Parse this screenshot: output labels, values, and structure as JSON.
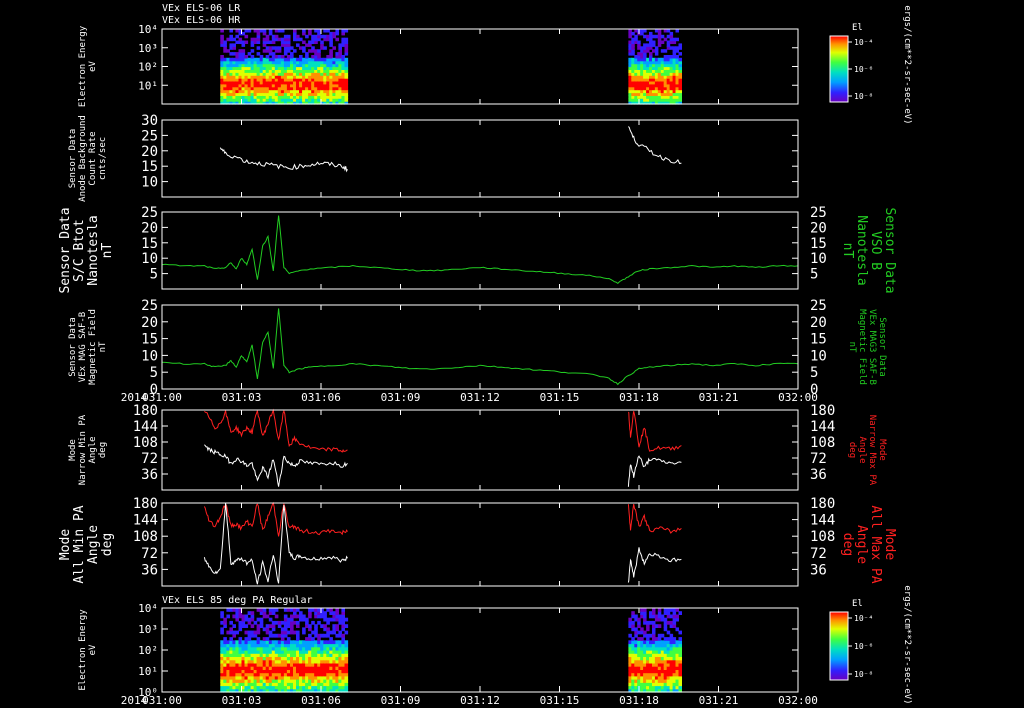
{
  "header": {
    "line1": "VEx ELS-06 LR",
    "line2": "VEx ELS-06 HR",
    "bottom_title": "VEx ELS 85 deg PA Regular"
  },
  "colors": {
    "white": "#ffffff",
    "green": "#22cc22",
    "red": "#ff2020",
    "axis": "#ffffff",
    "background": "#000000"
  },
  "time_axis": {
    "year_label": "2014",
    "ticks": [
      "031:00",
      "031:03",
      "031:06",
      "031:09",
      "031:12",
      "031:15",
      "031:18",
      "031:21",
      "032:00"
    ],
    "range_min": [
      0,
      60
    ]
  },
  "colorbars": [
    {
      "title": "El",
      "ticks": [
        "10⁻⁴",
        "10⁻⁶",
        "10⁻⁸"
      ],
      "unit_label": "ergs/(cm**2-sr-sec-eV)"
    },
    {
      "title": "El",
      "ticks": [
        "10⁻⁴",
        "10⁻⁶",
        "10⁻⁸"
      ],
      "unit_label": "ergs/(cm**2-sr-sec-eV)"
    }
  ],
  "chart_data": [
    {
      "type": "heatmap",
      "ylabel": [
        "Electron Energy",
        "eV"
      ],
      "yscale": "log",
      "ylim": [
        1,
        10000
      ],
      "ytick_labels": [
        "10⁴",
        "10³",
        "10²",
        "10¹"
      ],
      "data_intervals_min": [
        [
          5.5,
          17.5
        ],
        [
          44,
          49
        ]
      ],
      "colorscale": [
        "#6a00c0",
        "#3020ff",
        "#00a0ff",
        "#00e0c0",
        "#40ff40",
        "#e0ff00",
        "#ff9000",
        "#ff0000"
      ]
    },
    {
      "type": "line",
      "ylabel": [
        "Sensor Data",
        "Anode Background",
        "Count Rate",
        "cnts/sec"
      ],
      "ylim": [
        5,
        30
      ],
      "yticks": [
        10,
        15,
        20,
        25,
        30
      ],
      "series": [
        {
          "color": "white",
          "x": [
            5.5,
            6,
            7,
            8,
            9,
            10,
            11,
            12,
            13,
            14,
            15,
            16,
            17,
            17.5
          ],
          "values": [
            21,
            19,
            18,
            16.5,
            16,
            15.5,
            15,
            14.5,
            15,
            15.5,
            16,
            15.5,
            15,
            14
          ]
        },
        {
          "color": "white",
          "x": [
            44,
            44.5,
            45,
            46,
            47,
            48,
            49
          ],
          "values": [
            28,
            24,
            22,
            20,
            18,
            17,
            16
          ]
        }
      ]
    },
    {
      "type": "line",
      "ylabel": [
        "Sensor Data",
        "S/C Btot",
        "Nanotesla",
        "nT"
      ],
      "ylabel_right": [
        "Sensor Data",
        "VSO B",
        "Nanotesla",
        "nT"
      ],
      "ylim": [
        0,
        25
      ],
      "yticks": [
        5,
        10,
        15,
        20,
        25
      ],
      "series": [
        {
          "color": "green",
          "x": [
            0,
            2,
            4,
            5,
            6,
            6.5,
            7,
            7.5,
            8,
            8.5,
            9,
            9.5,
            10,
            10.5,
            11,
            11.5,
            12,
            13,
            14,
            16,
            18,
            20,
            22,
            24,
            26,
            28,
            30,
            32,
            34,
            36,
            38,
            40,
            42,
            43,
            44,
            45,
            46,
            48,
            50,
            52,
            54,
            56,
            58,
            60
          ],
          "values": [
            8,
            7.5,
            7.5,
            6.5,
            7,
            8.5,
            6.5,
            10,
            8,
            13,
            3,
            14,
            17,
            6,
            24,
            7,
            5,
            6,
            6.5,
            7,
            7.5,
            7,
            6.5,
            6,
            6,
            6.5,
            7,
            6.5,
            6,
            5.5,
            5,
            4.5,
            3.5,
            2,
            4,
            6,
            6.5,
            7,
            7.5,
            7,
            7.5,
            7,
            7.5,
            7.5
          ]
        }
      ]
    },
    {
      "type": "line",
      "ylabel": [
        "Sensor Data",
        "VEx MAG SAF-B",
        "Magnetic Field",
        "nT"
      ],
      "ylabel_right": [
        "Sensor Data",
        "VEx MAG3 SAF-B",
        "Magnetic Field",
        "nT"
      ],
      "ylim": [
        0,
        25
      ],
      "yticks": [
        0,
        5,
        10,
        15,
        20,
        25
      ],
      "series": [
        {
          "color": "green",
          "x": [
            0,
            2,
            4,
            5,
            6,
            6.5,
            7,
            7.5,
            8,
            8.5,
            9,
            9.5,
            10,
            10.5,
            11,
            11.5,
            12,
            13,
            14,
            16,
            18,
            20,
            22,
            24,
            26,
            28,
            30,
            32,
            34,
            36,
            38,
            40,
            42,
            43,
            44,
            45,
            46,
            48,
            50,
            52,
            54,
            56,
            58,
            60
          ],
          "values": [
            8,
            7.5,
            7.5,
            6.5,
            7,
            8.5,
            6.5,
            10,
            8,
            13,
            3,
            14,
            17,
            6,
            24,
            7,
            5,
            6,
            6.5,
            7,
            7.5,
            7,
            6.5,
            6,
            6,
            6.5,
            7,
            6.5,
            6,
            5.5,
            5,
            4.5,
            3.5,
            1.5,
            4,
            6,
            6.5,
            7,
            7.5,
            7,
            7.5,
            7,
            7.5,
            7.5
          ]
        }
      ]
    },
    {
      "type": "line",
      "ylabel": [
        "Mode",
        "Narrow Min PA",
        "Angle",
        "deg"
      ],
      "ylabel_right": [
        "Mode",
        "Narrow Max PA",
        "Angle",
        "deg"
      ],
      "ylim": [
        0,
        180
      ],
      "yticks": [
        36,
        72,
        108,
        144,
        180
      ],
      "series": [
        {
          "color": "red",
          "x": [
            4,
            4.5,
            5,
            5.5,
            6,
            6.5,
            7,
            7.5,
            8,
            8.5,
            9,
            9.5,
            10,
            10.5,
            11,
            11.5,
            12,
            12.5,
            13,
            14,
            15,
            16,
            17,
            17.5
          ],
          "values": [
            180,
            160,
            140,
            150,
            175,
            130,
            140,
            125,
            140,
            130,
            180,
            120,
            150,
            180,
            110,
            180,
            100,
            115,
            105,
            95,
            90,
            92,
            88,
            90
          ]
        },
        {
          "color": "white",
          "x": [
            4,
            4.5,
            5,
            5.5,
            6,
            6.5,
            7,
            7.5,
            8,
            8.5,
            9,
            9.5,
            10,
            10.5,
            11,
            11.5,
            12,
            12.5,
            13,
            14,
            15,
            16,
            17,
            17.5
          ],
          "values": [
            100,
            90,
            85,
            80,
            75,
            60,
            70,
            65,
            55,
            60,
            20,
            50,
            30,
            70,
            10,
            75,
            60,
            55,
            65,
            60,
            58,
            62,
            55,
            60
          ]
        },
        {
          "color": "red",
          "x": [
            44,
            44.2,
            44.5,
            45,
            45.5,
            46,
            47,
            48,
            49
          ],
          "values": [
            180,
            120,
            180,
            100,
            140,
            90,
            95,
            92,
            100
          ]
        },
        {
          "color": "white",
          "x": [
            44,
            44.2,
            44.5,
            45,
            45.5,
            46,
            47,
            48,
            49
          ],
          "values": [
            10,
            60,
            30,
            80,
            50,
            70,
            65,
            60,
            62
          ]
        }
      ]
    },
    {
      "type": "line",
      "ylabel": [
        "Mode",
        "All Min PA",
        "Angle",
        "deg"
      ],
      "ylabel_right": [
        "Mode",
        "All Max PA",
        "Angle",
        "deg"
      ],
      "ylim": [
        0,
        180
      ],
      "yticks": [
        36,
        72,
        108,
        144,
        180
      ],
      "series": [
        {
          "color": "red",
          "x": [
            4,
            4.5,
            5,
            5.5,
            6,
            6.5,
            7,
            7.5,
            8,
            8.5,
            9,
            9.5,
            10,
            10.5,
            11,
            11.5,
            12,
            12.5,
            13,
            14,
            15,
            16,
            17,
            17.5
          ],
          "values": [
            170,
            140,
            130,
            150,
            180,
            130,
            135,
            125,
            140,
            130,
            180,
            120,
            150,
            180,
            110,
            180,
            125,
            130,
            120,
            118,
            115,
            120,
            115,
            118
          ]
        },
        {
          "color": "white",
          "x": [
            4,
            4.5,
            5,
            5.5,
            6,
            6.5,
            7,
            7.5,
            8,
            8.5,
            9,
            9.5,
            10,
            10.5,
            11,
            11.5,
            12,
            12.5,
            13,
            14,
            15,
            16,
            17,
            17.5
          ],
          "values": [
            60,
            40,
            30,
            35,
            180,
            50,
            55,
            60,
            50,
            55,
            5,
            50,
            10,
            70,
            5,
            180,
            70,
            60,
            65,
            58,
            60,
            62,
            55,
            60
          ]
        },
        {
          "color": "red",
          "x": [
            44,
            44.2,
            44.5,
            45,
            45.5,
            46,
            47,
            48,
            49
          ],
          "values": [
            180,
            120,
            180,
            130,
            150,
            120,
            125,
            118,
            125
          ]
        },
        {
          "color": "white",
          "x": [
            44,
            44.2,
            44.5,
            45,
            45.5,
            46,
            47,
            48,
            49
          ],
          "values": [
            5,
            60,
            20,
            80,
            50,
            70,
            65,
            55,
            58
          ]
        }
      ]
    },
    {
      "type": "heatmap",
      "ylabel": [
        "Electron Energy",
        "eV"
      ],
      "yscale": "log",
      "ylim": [
        1,
        10000
      ],
      "ytick_labels": [
        "10⁴",
        "10³",
        "10²",
        "10¹",
        "10⁰"
      ],
      "data_intervals_min": [
        [
          5.5,
          17.5
        ],
        [
          44,
          49
        ]
      ],
      "colorscale": [
        "#6a00c0",
        "#3020ff",
        "#00a0ff",
        "#00e0c0",
        "#40ff40",
        "#e0ff00",
        "#ff9000",
        "#ff0000"
      ]
    }
  ]
}
